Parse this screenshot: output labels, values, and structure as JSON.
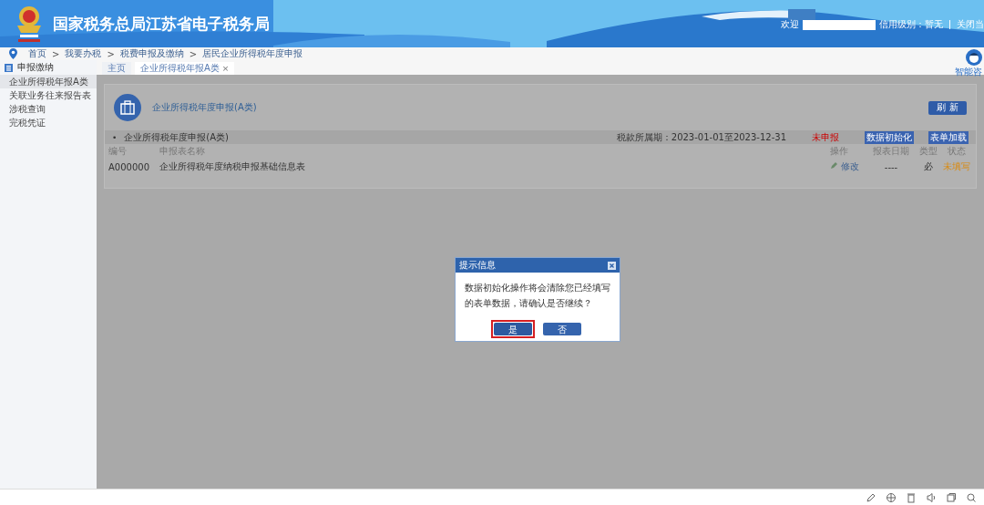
{
  "header": {
    "title": "国家税务总局江苏省电子税务局",
    "welcome": "欢迎",
    "credit": "信用级别：暂无",
    "close": "关闭当"
  },
  "breadcrumb": [
    "首页",
    "我要办税",
    "税费申报及缴纳",
    "居民企业所得税年度申报"
  ],
  "breadcrumb_separator": ">",
  "assistant": {
    "label": "智能咨"
  },
  "tabs": [
    {
      "label": "主页",
      "selected": false
    },
    {
      "label": "企业所得税年报A类",
      "selected": true,
      "close": "×"
    }
  ],
  "sidebar": {
    "title": "申报缴纳",
    "items": [
      {
        "label": "企业所得税年报A类",
        "selected": true
      },
      {
        "label": "关联业务往来报告表",
        "selected": false
      },
      {
        "label": "涉税查询",
        "selected": false
      },
      {
        "label": "完税凭证",
        "selected": false
      }
    ]
  },
  "panel": {
    "title": "企业所得税年度申报(A类)",
    "refresh": "刷 新",
    "section": {
      "bullet": "•",
      "title": "企业所得税年度申报(A类)",
      "period": "税款所属期：2023-01-01至2023-12-31",
      "status": "未申报",
      "buttons": [
        "数据初始化",
        "表单加载"
      ]
    },
    "columns": [
      "编号",
      "申报表名称",
      "操作",
      "报表日期",
      "类型",
      "状态"
    ],
    "rows": [
      {
        "code": "A000000",
        "name": "企业所得税年度纳税申报基础信息表",
        "action": "修改",
        "date": "----",
        "type": "必",
        "status": "未填写"
      }
    ]
  },
  "dialog": {
    "title": "提示信息",
    "message": "数据初始化操作将会清除您已经填写的表单数据，请确认是否继续？",
    "buttons": [
      {
        "label": "是",
        "selected": true
      },
      {
        "label": "否",
        "selected": false
      }
    ]
  }
}
